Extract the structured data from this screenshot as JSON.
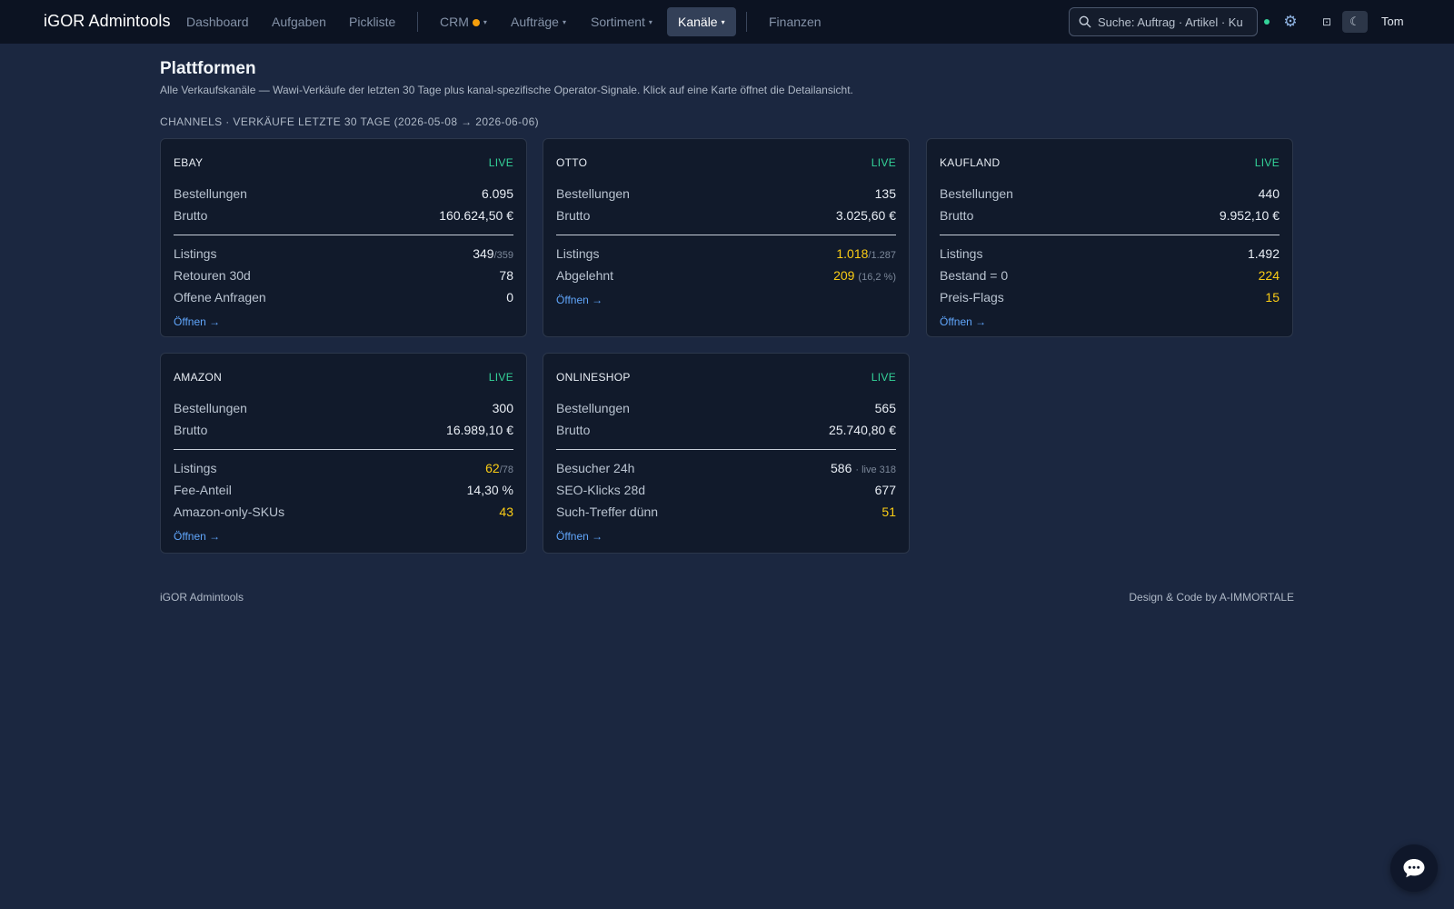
{
  "nav": {
    "brand": "iGOR Admintools",
    "items": [
      {
        "label": "Dashboard"
      },
      {
        "label": "Aufgaben"
      },
      {
        "label": "Pickliste"
      },
      {
        "label": "CRM"
      },
      {
        "label": "Aufträge"
      },
      {
        "label": "Sortiment"
      },
      {
        "label": "Kanäle"
      },
      {
        "label": "Finanzen"
      }
    ],
    "caret": "▾",
    "active": "Kanäle",
    "search_placeholder": "Suche: Auftrag · Artikel · Kunde",
    "user": "Tom",
    "icons": {
      "search": "search-icon",
      "gear": "gear-icon",
      "layout": "layout-icon",
      "theme": "moon-icon",
      "chat": "chat-icon"
    },
    "colors": {
      "crm_dot": "#f59e0b",
      "status_dot": "#34d399",
      "link": "#60a5fa",
      "warn": "#facc15",
      "live": "#34d399"
    }
  },
  "header": {
    "title": "Plattformen",
    "description": "Alle Verkaufskanäle — Wawi-Verkäufe der letzten 30 Tage plus kanal-spezifische Operator-Signale. Klick auf eine Karte öffnet die Detailansicht.",
    "section_label": "CHANNELS · VERKÄUFE LETZTE 30 TAGE (2026-05-08 → 2026-06-06)"
  },
  "cards": [
    {
      "name": "EBAY",
      "status": "LIVE",
      "orders_label": "Bestellungen",
      "orders": "6.095",
      "gross_label": "Brutto",
      "gross": "160.624,50 €",
      "rows": [
        {
          "label": "Listings",
          "value": "349",
          "sub": "/359"
        },
        {
          "label": "Retouren 30d",
          "value": "78"
        },
        {
          "label": "Offene Anfragen",
          "value": "0"
        }
      ],
      "link": "Öffnen →"
    },
    {
      "name": "OTTO",
      "status": "LIVE",
      "orders_label": "Bestellungen",
      "orders": "135",
      "gross_label": "Brutto",
      "gross": "3.025,60 €",
      "rows": [
        {
          "label": "Listings",
          "value": "1.018",
          "sub": "/1.287",
          "warn": true
        },
        {
          "label": "Abgelehnt",
          "value": "209",
          "sub": "(16,2 %)",
          "warn": true
        }
      ],
      "link": "Öffnen →"
    },
    {
      "name": "KAUFLAND",
      "status": "LIVE",
      "orders_label": "Bestellungen",
      "orders": "440",
      "gross_label": "Brutto",
      "gross": "9.952,10 €",
      "rows": [
        {
          "label": "Listings",
          "value": "1.492"
        },
        {
          "label": "Bestand = 0",
          "value": "224",
          "warn": true
        },
        {
          "label": "Preis-Flags",
          "value": "15",
          "warn": true
        }
      ],
      "link": "Öffnen →"
    },
    {
      "name": "AMAZON",
      "status": "LIVE",
      "orders_label": "Bestellungen",
      "orders": "300",
      "gross_label": "Brutto",
      "gross": "16.989,10 €",
      "rows": [
        {
          "label": "Listings",
          "value": "62",
          "sub": "/78",
          "warn": true
        },
        {
          "label": "Fee-Anteil",
          "value": "14,30 %"
        },
        {
          "label": "Amazon-only-SKUs",
          "value": "43",
          "warn": true
        }
      ],
      "link": "Öffnen →"
    },
    {
      "name": "ONLINESHOP",
      "status": "LIVE",
      "orders_label": "Bestellungen",
      "orders": "565",
      "gross_label": "Brutto",
      "gross": "25.740,80 €",
      "rows": [
        {
          "label": "Besucher 24h",
          "value": "586",
          "sub": "· live 318"
        },
        {
          "label": "SEO-Klicks 28d",
          "value": "677"
        },
        {
          "label": "Such-Treffer dünn",
          "value": "51",
          "warn": true
        }
      ],
      "link": "Öffnen →"
    }
  ],
  "footer": {
    "left": "iGOR Admintools",
    "right": "Design & Code by A-IMMORTALE"
  }
}
